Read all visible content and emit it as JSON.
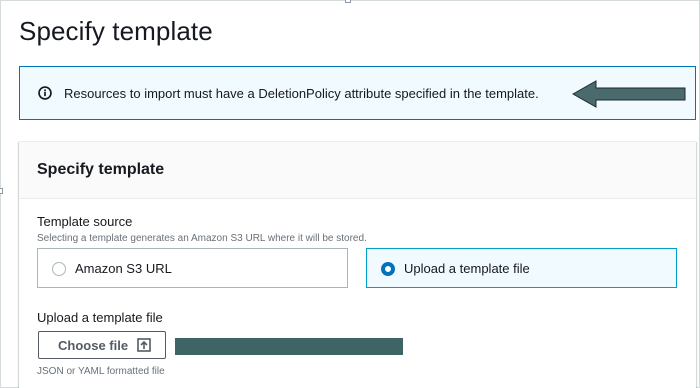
{
  "page": {
    "title": "Specify template"
  },
  "alert": {
    "type": "info",
    "icon": "info-circle-icon",
    "text": "Resources to import must have a DeletionPolicy attribute specified in the template."
  },
  "annotation": {
    "icon": "left-arrow-icon",
    "color": "#4a6b6e"
  },
  "panel": {
    "title": "Specify template",
    "template_source": {
      "label": "Template source",
      "description": "Selecting a template generates an Amazon S3 URL where it will be stored.",
      "options": [
        {
          "label": "Amazon S3 URL",
          "selected": false
        },
        {
          "label": "Upload a template file",
          "selected": true
        }
      ]
    },
    "upload": {
      "label": "Upload a template file",
      "button_label": "Choose file",
      "button_icon": "upload-icon",
      "constraint": "JSON or YAML formatted file"
    }
  },
  "colors": {
    "accent": "#0073bb",
    "selected_border": "#00a1c9",
    "info_background": "#f1faff",
    "redaction": "#3f6466"
  }
}
